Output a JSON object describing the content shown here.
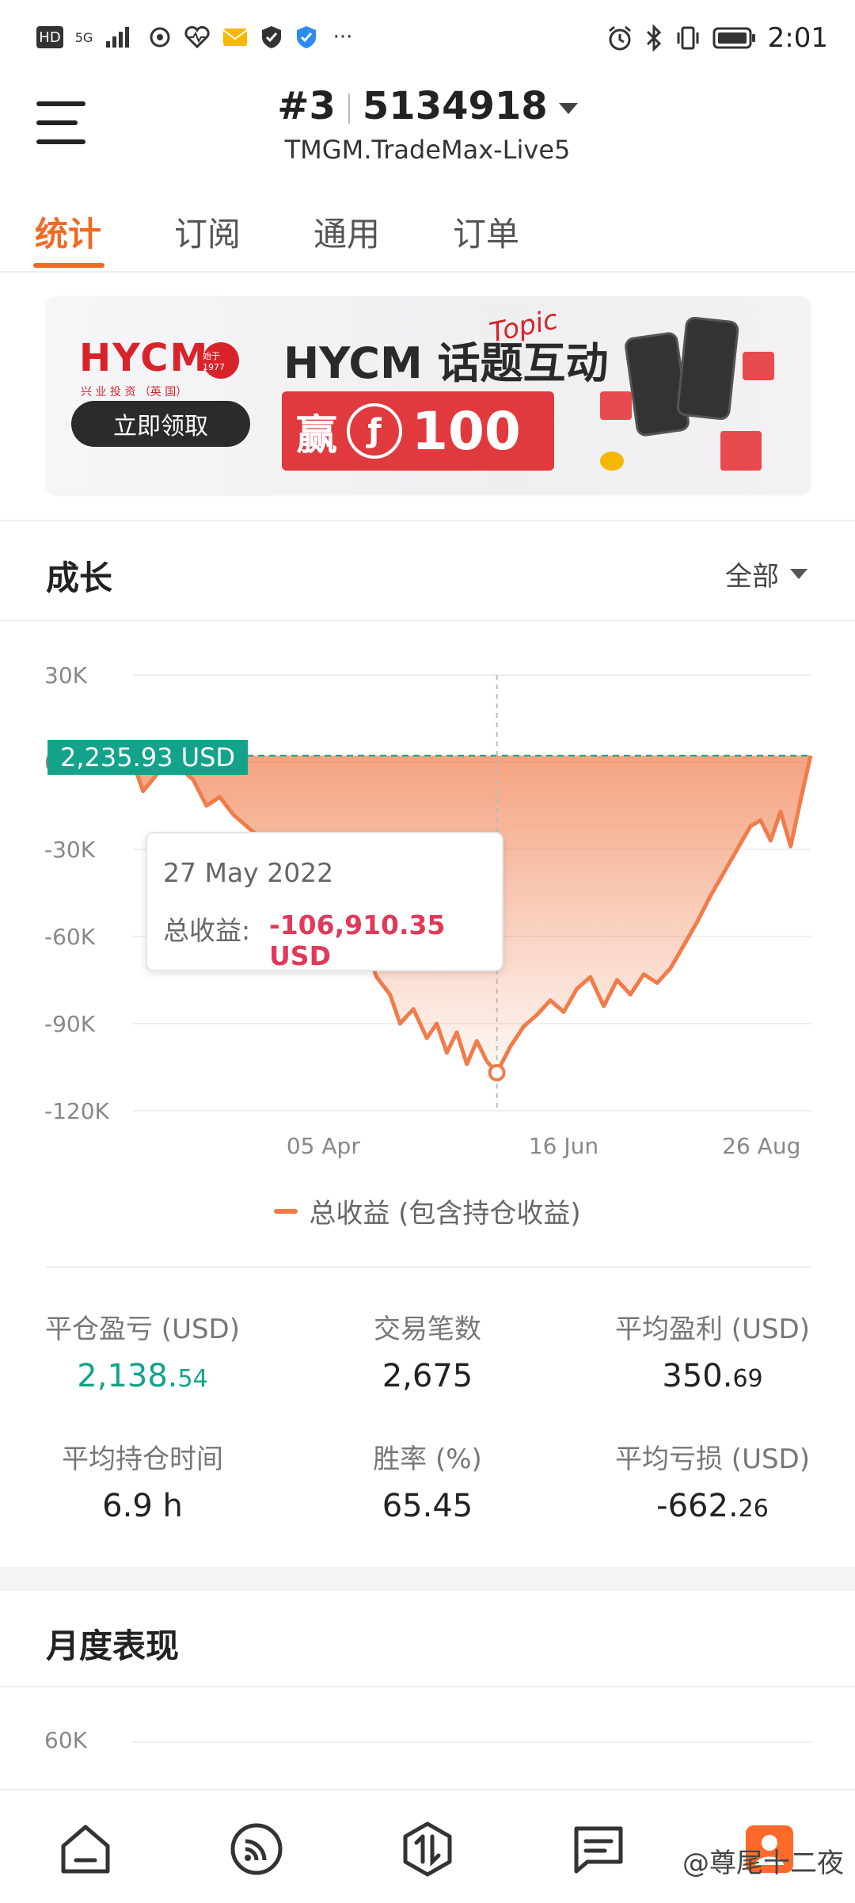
{
  "status_bar": {
    "left_indicators": [
      "HD",
      "5G",
      "signal-icon",
      "sync-icon",
      "heart-monitor-icon",
      "mail-icon",
      "shield-icon",
      "shield-check-icon",
      "more-icon"
    ],
    "hd_text": "HD",
    "network_text": "5G",
    "more_text": "···",
    "time": "2:01"
  },
  "header": {
    "account_number": "#3",
    "account_id": "5134918",
    "server": "TMGM.TradeMax-Live5"
  },
  "tabs": [
    {
      "label": "统计",
      "active": true
    },
    {
      "label": "订阅",
      "active": false
    },
    {
      "label": "通用",
      "active": false
    },
    {
      "label": "订单",
      "active": false
    }
  ],
  "banner": {
    "logo": "HYCM",
    "logo_sub": "兴 业 投 资 （英 国）",
    "seal": "始于1977",
    "cta": "立即领取",
    "title": "HYCM 话题互动",
    "script": "Topic",
    "prize_char": "赢",
    "coin_symbol": "ƒ",
    "prize_amount": "100"
  },
  "growth": {
    "title": "成长",
    "filter": "全部",
    "current_label": "2,235.93 USD",
    "tooltip": {
      "date": "27 May 2022",
      "label": "总收益:",
      "value": "-106,910.35 USD"
    },
    "legend": "总收益 (包含持仓收益)"
  },
  "chart_data": {
    "type": "area",
    "title": "",
    "xlabel": "",
    "ylabel": "",
    "ylim": [
      -120000,
      30000
    ],
    "y_ticks": [
      "30K",
      "0",
      "-30K",
      "-60K",
      "-90K",
      "-120K"
    ],
    "x_ticks": [
      "05 Apr",
      "16 Jun",
      "26 Aug"
    ],
    "grid": true,
    "color": "#f07c4a",
    "series": [
      {
        "name": "总收益 (包含持仓收益)",
        "x": [
          "2022-02-07",
          "2022-02-10",
          "2022-02-15",
          "2022-02-20",
          "2022-02-25",
          "2022-03-01",
          "2022-03-05",
          "2022-03-09",
          "2022-03-13",
          "2022-03-17",
          "2022-03-21",
          "2022-03-26",
          "2022-03-31",
          "2022-04-05",
          "2022-04-09",
          "2022-04-13",
          "2022-04-17",
          "2022-04-21",
          "2022-04-25",
          "2022-04-28",
          "2022-05-02",
          "2022-05-06",
          "2022-05-09",
          "2022-05-12",
          "2022-05-15",
          "2022-05-18",
          "2022-05-21",
          "2022-05-24",
          "2022-05-27",
          "2022-05-31",
          "2022-06-04",
          "2022-06-08",
          "2022-06-12",
          "2022-06-16",
          "2022-06-20",
          "2022-06-24",
          "2022-06-28",
          "2022-07-02",
          "2022-07-06",
          "2022-07-10",
          "2022-07-14",
          "2022-07-18",
          "2022-07-22",
          "2022-07-26",
          "2022-07-30",
          "2022-08-03",
          "2022-08-07",
          "2022-08-11",
          "2022-08-14",
          "2022-08-17",
          "2022-08-20",
          "2022-08-23",
          "2022-08-26",
          "2022-08-29"
        ],
        "values": [
          0,
          -10000,
          -3000,
          -1000,
          -6000,
          -15000,
          -12000,
          -18000,
          -22000,
          -26000,
          -31000,
          -42000,
          -38000,
          -50000,
          -45000,
          -58000,
          -62000,
          -74000,
          -80000,
          -90000,
          -85000,
          -95000,
          -90000,
          -100000,
          -93000,
          -104000,
          -96000,
          -103000,
          -106910,
          -98000,
          -91000,
          -87000,
          -82000,
          -86000,
          -78000,
          -74000,
          -84000,
          -75000,
          -80000,
          -73000,
          -76000,
          -71000,
          -63000,
          -55000,
          -46000,
          -38000,
          -30000,
          -22000,
          -20000,
          -27000,
          -17000,
          -29000,
          -13000,
          2236
        ]
      }
    ],
    "highlight": {
      "x": "2022-05-27",
      "y": -106910.35
    },
    "reference_line": 2235.93
  },
  "stats": [
    {
      "label": "平仓盈亏 (USD)",
      "int": "2,138.",
      "dec": "54",
      "color": "green"
    },
    {
      "label": "交易笔数",
      "int": "2,675",
      "dec": "",
      "color": "default"
    },
    {
      "label": "平均盈利 (USD)",
      "int": "350.",
      "dec": "69",
      "color": "default"
    },
    {
      "label": "平均持仓时间",
      "int": "6.9 h",
      "dec": "",
      "color": "default"
    },
    {
      "label": "胜率 (%)",
      "int": "65.45",
      "dec": "",
      "color": "default"
    },
    {
      "label": "平均亏损 (USD)",
      "int": "-662.",
      "dec": "26",
      "color": "default"
    }
  ],
  "monthly": {
    "title": "月度表现",
    "first_tick": "60K"
  },
  "bottom_nav": [
    {
      "name": "home-icon"
    },
    {
      "name": "signals-icon"
    },
    {
      "name": "trade-icon"
    },
    {
      "name": "messages-icon"
    },
    {
      "name": "profile-icon"
    }
  ],
  "watermark": "@尊尾十二夜"
}
